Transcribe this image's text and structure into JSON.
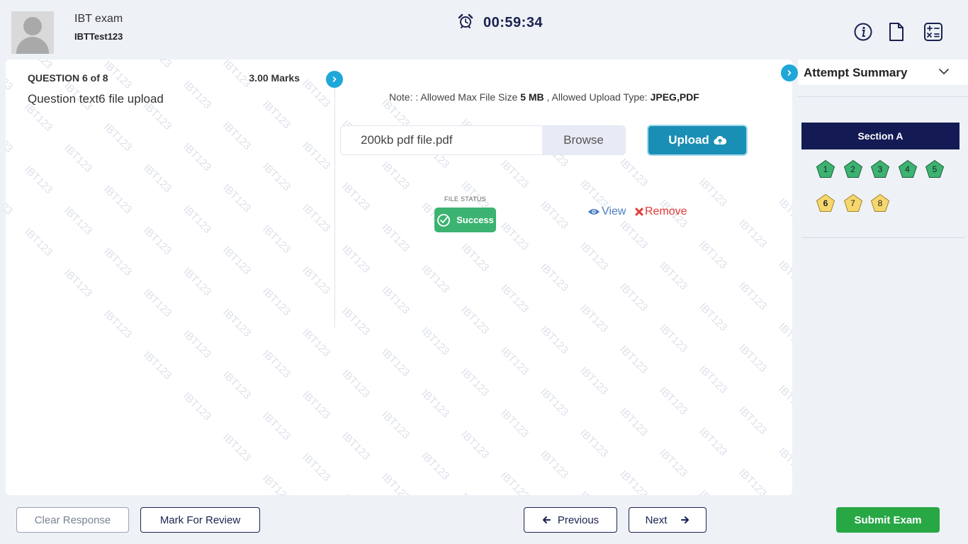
{
  "header": {
    "exam_name": "IBT exam",
    "user_id": "IBTTest123",
    "timer": "00:59:34",
    "icons": [
      "info-icon",
      "document-icon",
      "calculator-icon"
    ]
  },
  "watermark": {
    "text": "IBT123"
  },
  "question": {
    "counter": "QUESTION 6 of 8",
    "marks": "3.00 Marks",
    "text": "Question text6 file upload"
  },
  "upload": {
    "note_prefix": "Note: : Allowed Max File Size ",
    "max_size": "5 MB",
    "note_mid": " , Allowed Upload Type: ",
    "types": "JPEG,PDF",
    "file_name": "200kb pdf file.pdf",
    "browse_label": "Browse",
    "upload_label": "Upload",
    "status_label": "FILE STATUS",
    "status_value": "Success",
    "view_label": "View",
    "remove_label": "Remove"
  },
  "summary": {
    "title": "Attempt Summary",
    "section": "Section A",
    "questions": [
      {
        "n": "1",
        "state": "answered"
      },
      {
        "n": "2",
        "state": "answered"
      },
      {
        "n": "3",
        "state": "answered"
      },
      {
        "n": "4",
        "state": "answered"
      },
      {
        "n": "5",
        "state": "answered"
      },
      {
        "n": "6",
        "state": "current"
      },
      {
        "n": "7",
        "state": "not-visited"
      },
      {
        "n": "8",
        "state": "not-visited"
      }
    ],
    "colors": {
      "answered": "#3cb371",
      "pending": "#f5d76e",
      "section_bar": "#141a54"
    }
  },
  "footer": {
    "clear_label": "Clear Response",
    "mark_label": "Mark For Review",
    "previous_label": "Previous",
    "next_label": "Next",
    "submit_label": "Submit Exam"
  }
}
